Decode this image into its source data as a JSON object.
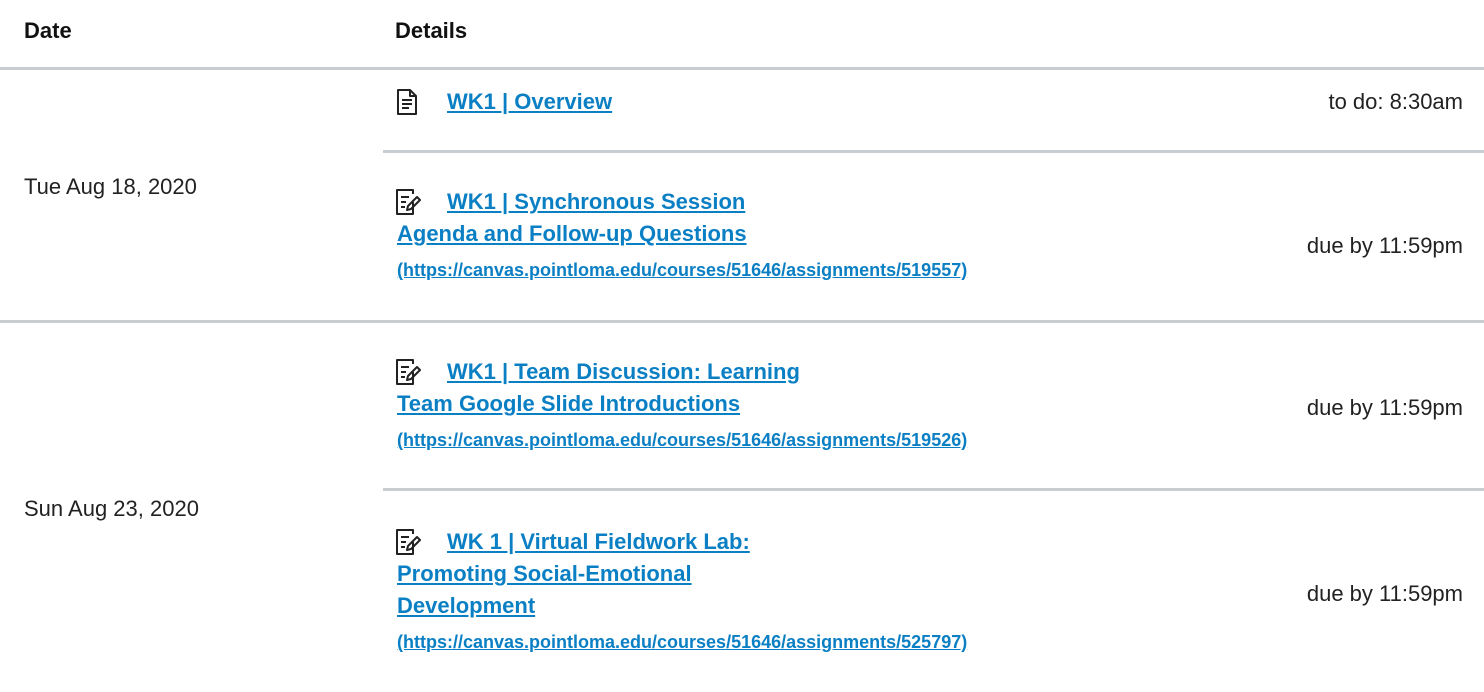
{
  "table": {
    "headers": {
      "date": "Date",
      "details": "Details"
    }
  },
  "groups": [
    {
      "date": "Tue Aug 18, 2020",
      "items": [
        {
          "icon": "document-icon",
          "title_lines": [
            "WK1 | Overview"
          ],
          "url": "",
          "due": "to do: 8:30am"
        },
        {
          "icon": "assignment-icon",
          "title_lines": [
            "WK1 | Synchronous Session",
            "Agenda and Follow-up Questions"
          ],
          "url": "(https://canvas.pointloma.edu/courses/51646/assignments/519557)",
          "due": "due by 11:59pm"
        }
      ]
    },
    {
      "date": "Sun Aug 23, 2020",
      "items": [
        {
          "icon": "assignment-icon",
          "title_lines": [
            "WK1 | Team Discussion: Learning",
            "Team Google Slide Introductions"
          ],
          "url": "(https://canvas.pointloma.edu/courses/51646/assignments/519526)",
          "due": "due by 11:59pm"
        },
        {
          "icon": "assignment-icon",
          "title_lines": [
            "WK 1 | Virtual Fieldwork Lab:",
            "Promoting Social-Emotional",
            "Development"
          ],
          "url": "(https://canvas.pointloma.edu/courses/51646/assignments/525797)",
          "due": "due by 11:59pm"
        }
      ]
    }
  ],
  "colors": {
    "link": "#0b7fc4",
    "rule": "#c7cdd1",
    "text": "#222222"
  }
}
